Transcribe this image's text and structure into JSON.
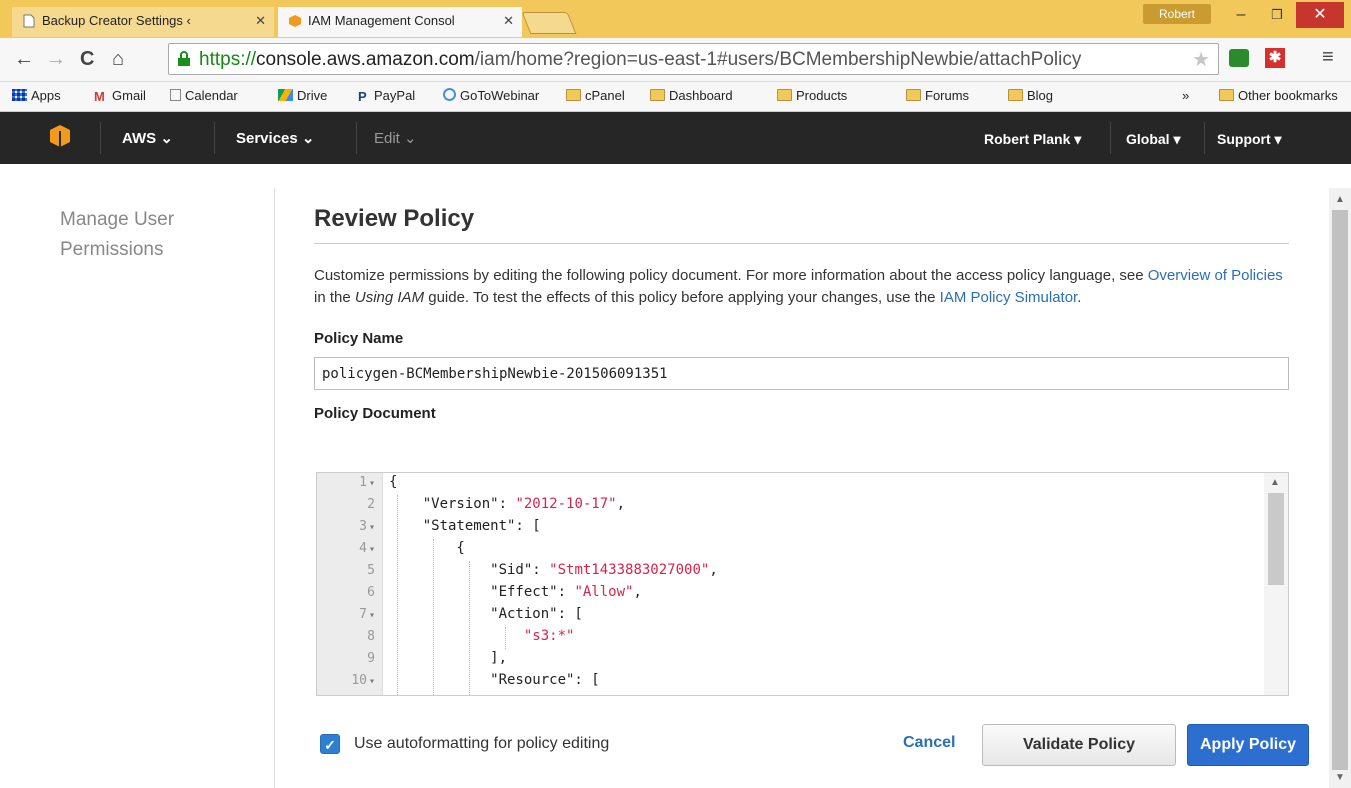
{
  "browser": {
    "tabs": [
      {
        "title": "Backup Creator Settings ‹",
        "active": false
      },
      {
        "title": "IAM Management Consol",
        "active": true
      }
    ],
    "profile": "Robert",
    "url": {
      "scheme": "https://",
      "host": "console.aws.amazon.com",
      "path": "/iam/home?region=us-east-1#users/BCMembershipNewbie/attachPolicy"
    },
    "bookmarks": [
      "Apps",
      "Gmail",
      "Calendar",
      "Drive",
      "PayPal",
      "GoToWebinar",
      "cPanel",
      "Dashboard",
      "Products",
      "Forums",
      "Blog"
    ],
    "bookmarks_overflow": "»",
    "other_bookmarks": "Other bookmarks"
  },
  "aws_nav": {
    "aws": "AWS",
    "services": "Services",
    "edit": "Edit",
    "user": "Robert Plank",
    "region": "Global",
    "support": "Support"
  },
  "sidebar": {
    "title": "Manage User Permissions"
  },
  "main": {
    "title": "Review Policy",
    "desc_1": "Customize permissions by editing the following policy document. For more information about the access policy language, see ",
    "desc_link_1": "Overview of Policies",
    "desc_2": " in the ",
    "desc_em": "Using IAM",
    "desc_3": " guide. To test the effects of this policy before applying your changes, use the ",
    "desc_link_2": "IAM Policy Simulator",
    "desc_4": ".",
    "policy_name_label": "Policy Name",
    "policy_name_value": "policygen-BCMembershipNewbie-201506091351",
    "policy_doc_label": "Policy Document"
  },
  "editor": {
    "lines": [
      {
        "n": "1",
        "fold": true,
        "text": "{"
      },
      {
        "n": "2",
        "fold": false,
        "key": "    \"Version\": ",
        "str": "\"2012-10-17\"",
        "tail": ","
      },
      {
        "n": "3",
        "fold": true,
        "text": "    \"Statement\": ["
      },
      {
        "n": "4",
        "fold": true,
        "text": "        {"
      },
      {
        "n": "5",
        "fold": false,
        "key": "            \"Sid\": ",
        "str": "\"Stmt1433883027000\"",
        "tail": ","
      },
      {
        "n": "6",
        "fold": false,
        "key": "            \"Effect\": ",
        "str": "\"Allow\"",
        "tail": ","
      },
      {
        "n": "7",
        "fold": true,
        "text": "            \"Action\": ["
      },
      {
        "n": "8",
        "fold": false,
        "key": "                ",
        "str": "\"s3:*\"",
        "tail": ""
      },
      {
        "n": "9",
        "fold": false,
        "text": "            ],"
      },
      {
        "n": "10",
        "fold": true,
        "text": "            \"Resource\": ["
      }
    ]
  },
  "actions": {
    "autoformat_label": "Use autoformatting for policy editing",
    "autoformat_checked": true,
    "cancel": "Cancel",
    "validate": "Validate Policy",
    "apply": "Apply Policy"
  },
  "colors": {
    "aws_nav_bg": "#262626",
    "primary_button": "#2c6fd0",
    "link": "#2a6fb4",
    "json_string": "#d6244a"
  }
}
